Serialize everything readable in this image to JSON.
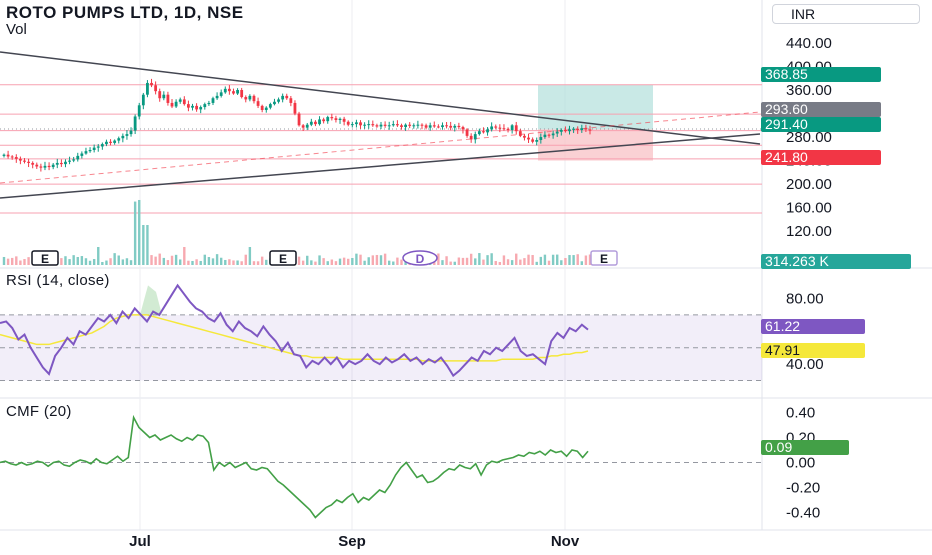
{
  "header": {
    "title": "ROTO PUMPS LTD, 1D, NSE",
    "volume_label": "Vol",
    "currency": "INR"
  },
  "colors": {
    "up": "#089981",
    "down": "#f23645",
    "level_line": "#f7a1b0",
    "rsi_line": "#7e57c2",
    "rsi_ma": "#f5e83b",
    "cmf_line": "#43a047",
    "target_zone": "#b2dfdb",
    "stop_zone": "#f8c2c6",
    "trend_line": "#434651"
  },
  "chart_data": [
    {
      "type": "candlestick",
      "name": "price",
      "y_axis_ticks": [
        "440.00",
        "400.00",
        "360.00",
        "320.00",
        "280.00",
        "240.00",
        "200.00",
        "160.00",
        "120.00"
      ],
      "ylim": [
        105,
        445
      ],
      "x_axis_ticks": [
        "Jul",
        "Sep",
        "Nov"
      ],
      "horizontal_levels": [
        369,
        319,
        291,
        266,
        243,
        200,
        151
      ],
      "tags": {
        "target": "368.85",
        "current_gray": "293.60",
        "current": "291.40",
        "stop": "241.80",
        "volume": "314.263 K"
      },
      "event_markers": [
        "E",
        "E",
        "D",
        "E"
      ],
      "candles_close": [
        250,
        247,
        246,
        243,
        240,
        238,
        236,
        233,
        230,
        228,
        231,
        229,
        233,
        236,
        234,
        238,
        240,
        242,
        248,
        252,
        256,
        258,
        262,
        264,
        268,
        272,
        270,
        274,
        278,
        282,
        285,
        291,
        315,
        334,
        352,
        372,
        368,
        358,
        346,
        352,
        338,
        332,
        340,
        344,
        336,
        330,
        333,
        327,
        331,
        336,
        338,
        346,
        350,
        356,
        362,
        358,
        354,
        360,
        348,
        344,
        350,
        341,
        333,
        326,
        330,
        336,
        340,
        344,
        350,
        346,
        338,
        320,
        300,
        296,
        301,
        306,
        302,
        310,
        307,
        314,
        312,
        309,
        311,
        306,
        301,
        302,
        305,
        300,
        301,
        302,
        300,
        298,
        301,
        299,
        300,
        302,
        300,
        297,
        301,
        299,
        300,
        301,
        300,
        296,
        300,
        298,
        297,
        300,
        299,
        296,
        299,
        297,
        293,
        282,
        276,
        285,
        290,
        288,
        293,
        298,
        296,
        295,
        294,
        292,
        300,
        290,
        282,
        279,
        276,
        272,
        275,
        280,
        284,
        283,
        286,
        289,
        292,
        290,
        293,
        294,
        292,
        295,
        293,
        291
      ]
    },
    {
      "type": "line",
      "name": "RSI (14, close)",
      "y_axis_ticks": [
        "80.00",
        "40.00"
      ],
      "ylim": [
        23,
        87
      ],
      "bands": [
        70,
        50,
        30
      ],
      "last_value": "61.22",
      "ma_last_value": "47.91",
      "values": [
        65,
        66,
        62,
        55,
        58,
        50,
        44,
        38,
        34,
        45,
        50,
        56,
        52,
        60,
        58,
        63,
        68,
        66,
        70,
        65,
        72,
        68,
        74,
        70,
        66,
        72,
        70,
        76,
        82,
        88,
        83,
        78,
        74,
        72,
        68,
        66,
        71,
        64,
        60,
        66,
        62,
        60,
        57,
        63,
        58,
        54,
        48,
        53,
        46,
        45,
        38,
        42,
        40,
        44,
        40,
        44,
        38,
        42,
        40,
        42,
        46,
        42,
        40,
        44,
        41,
        43,
        46,
        42,
        44,
        40,
        43,
        41,
        44,
        39,
        33,
        36,
        40,
        44,
        42,
        48,
        46,
        50,
        48,
        52,
        56,
        48,
        45,
        46,
        43,
        40,
        54,
        59,
        56,
        62,
        60,
        64,
        61
      ],
      "ma_values": [
        58,
        57,
        56,
        55,
        54,
        53,
        52,
        52,
        52,
        53,
        54,
        55,
        56,
        57,
        58,
        59,
        61,
        63,
        66,
        68,
        69,
        70,
        70,
        70,
        70,
        69,
        68,
        67,
        66,
        65,
        64,
        63,
        62,
        61,
        60,
        59,
        58,
        57,
        56,
        55,
        54,
        53,
        52,
        51,
        50,
        49,
        48,
        47,
        46,
        45,
        45,
        44,
        44,
        44,
        44,
        44,
        43,
        43,
        43,
        43,
        43,
        43,
        43,
        43,
        43,
        43,
        43,
        43,
        43,
        42,
        42,
        42,
        42,
        42,
        42,
        42,
        42,
        42,
        42,
        42,
        42,
        42,
        43,
        43,
        43,
        43,
        43,
        43,
        44,
        44,
        45,
        45,
        46,
        46,
        47,
        47,
        48
      ]
    },
    {
      "type": "line",
      "name": "CMF (20)",
      "y_axis_ticks": [
        "0.40",
        "0.20",
        "0.00",
        "-0.20",
        "-0.40"
      ],
      "ylim": [
        -0.46,
        0.42
      ],
      "last_value": "0.09",
      "values": [
        0.0,
        0.01,
        -0.01,
        -0.02,
        0.0,
        -0.02,
        -0.01,
        0.01,
        0.0,
        -0.03,
        0.0,
        0.01,
        -0.02,
        -0.03,
        0.0,
        0.02,
        0.01,
        -0.01,
        0.03,
        0.0,
        -0.01,
        0.02,
        0.05,
        0.01,
        0.04,
        0.36,
        0.28,
        0.24,
        0.2,
        0.22,
        0.18,
        0.2,
        0.22,
        0.19,
        0.17,
        0.2,
        0.18,
        0.22,
        0.21,
        0.16,
        -0.06,
        0.0,
        -0.03,
        0.0,
        -0.04,
        -0.02,
        0.0,
        -0.05,
        -0.06,
        -0.04,
        -0.05,
        -0.1,
        -0.15,
        -0.18,
        -0.22,
        -0.26,
        -0.3,
        -0.34,
        -0.38,
        -0.44,
        -0.4,
        -0.36,
        -0.34,
        -0.3,
        -0.32,
        -0.28,
        -0.25,
        -0.32,
        -0.28,
        -0.3,
        -0.26,
        -0.22,
        -0.24,
        -0.18,
        -0.1,
        -0.04,
        0.0,
        -0.06,
        -0.12,
        -0.1,
        -0.16,
        -0.15,
        -0.12,
        -0.08,
        -0.05,
        -0.06,
        -0.02,
        -0.04,
        -0.05,
        -0.01,
        -0.1,
        -0.02,
        0.01,
        0.0,
        0.02,
        0.03,
        0.04,
        0.06,
        0.05,
        0.08,
        0.07,
        0.09,
        0.06,
        0.1,
        0.08,
        0.09,
        0.05,
        0.1,
        0.09,
        0.04,
        0.09
      ]
    }
  ]
}
